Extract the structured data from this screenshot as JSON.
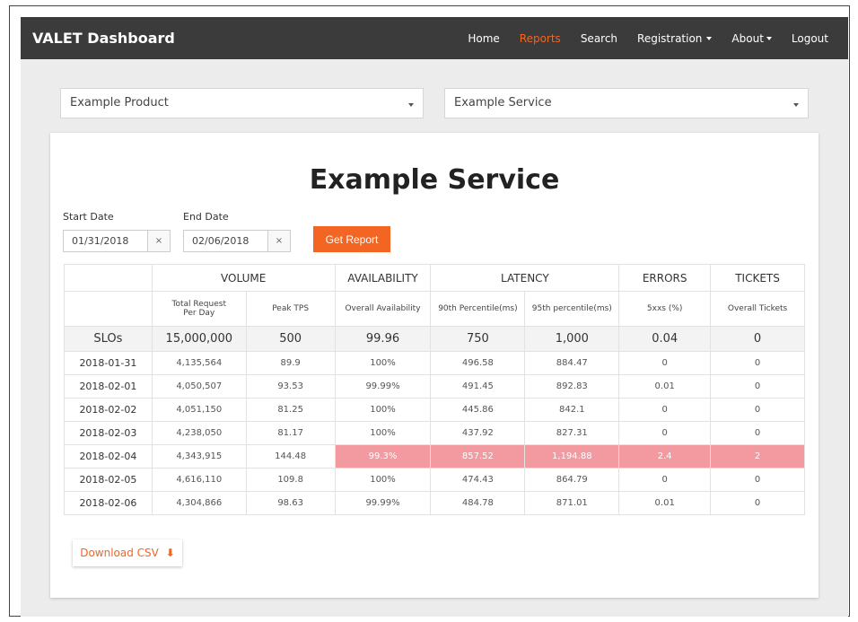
{
  "app": {
    "title": "VALET Dashboard"
  },
  "nav": {
    "home": "Home",
    "reports": "Reports",
    "search": "Search",
    "registration": "Registration",
    "about": "About",
    "logout": "Logout"
  },
  "filters": {
    "product": "Example Product",
    "service": "Example Service"
  },
  "report": {
    "title": "Example Service",
    "start_label": "Start Date",
    "start_value": "01/31/2018",
    "end_label": "End Date",
    "end_value": "02/06/2018",
    "clear_icon": "×",
    "get_report": "Get Report",
    "download": "Download CSV",
    "download_icon": "⬇"
  },
  "table": {
    "groups": [
      "VOLUME",
      "AVAILABILITY",
      "LATENCY",
      "ERRORS",
      "TICKETS"
    ],
    "columns": [
      "Total Request Per Day",
      "Peak TPS",
      "Overall Availability",
      "90th Percentile(ms)",
      "95th percentile(ms)",
      "5xxs (%)",
      "Overall Tickets"
    ],
    "slo": [
      "SLOs",
      "15,000,000",
      "500",
      "99.96",
      "750",
      "1,000",
      "0.04",
      "0"
    ],
    "rows": [
      [
        "2018-01-31",
        "4,135,564",
        "89.9",
        "100%",
        "496.58",
        "884.47",
        "0",
        "0"
      ],
      [
        "2018-02-01",
        "4,050,507",
        "93.53",
        "99.99%",
        "491.45",
        "892.83",
        "0.01",
        "0"
      ],
      [
        "2018-02-02",
        "4,051,150",
        "81.25",
        "100%",
        "445.86",
        "842.1",
        "0",
        "0"
      ],
      [
        "2018-02-03",
        "4,238,050",
        "81.17",
        "100%",
        "437.92",
        "827.31",
        "0",
        "0"
      ],
      [
        "2018-02-04",
        "4,343,915",
        "144.48",
        "99.3%",
        "857.52",
        "1,194.88",
        "2.4",
        "2"
      ],
      [
        "2018-02-05",
        "4,616,110",
        "109.8",
        "100%",
        "474.43",
        "864.79",
        "0",
        "0"
      ],
      [
        "2018-02-06",
        "4,304,866",
        "98.63",
        "99.99%",
        "484.78",
        "871.01",
        "0.01",
        "0"
      ]
    ]
  },
  "colors": {
    "accent": "#f26522",
    "violation": "#f29aa0",
    "navbar": "#3b3b3b"
  }
}
